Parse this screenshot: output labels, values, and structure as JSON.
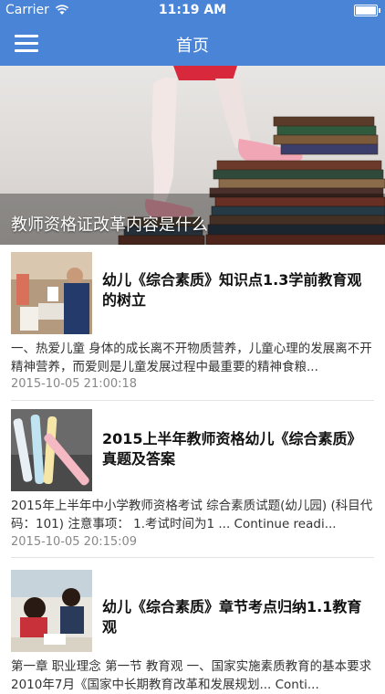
{
  "status_bar": {
    "carrier": "Carrier",
    "time": "11:19 AM"
  },
  "nav": {
    "title": "首页"
  },
  "hero": {
    "caption": "教师资格证改革内容是什么"
  },
  "articles": [
    {
      "title": "幼儿《综合素质》知识点1.3学前教育观的树立",
      "summary": "一、热爱儿童 身体的成长离不开物质营养，儿童心理的发展离不开精神营养，而爱则是儿童发展过程中最重要的精神食粮...",
      "date": "2015-10-05 21:00:18"
    },
    {
      "title": "2015上半年教师资格幼儿《综合素质》真题及答案",
      "summary": "2015年上半年中小学教师资格考试 综合素质试题(幼儿园) (科目代码：101) 注意事项： 1.考试时间为1 ... Continue readi...",
      "date": "2015-10-05 20:15:09"
    },
    {
      "title": "幼儿《综合素质》章节考点归纳1.1教育观",
      "summary": "第一章 职业理念 第一节 教育观 一、国家实施素质教育的基本要求 2010年7月《国家中长期教育改革和发展规划... Conti..."
    }
  ]
}
